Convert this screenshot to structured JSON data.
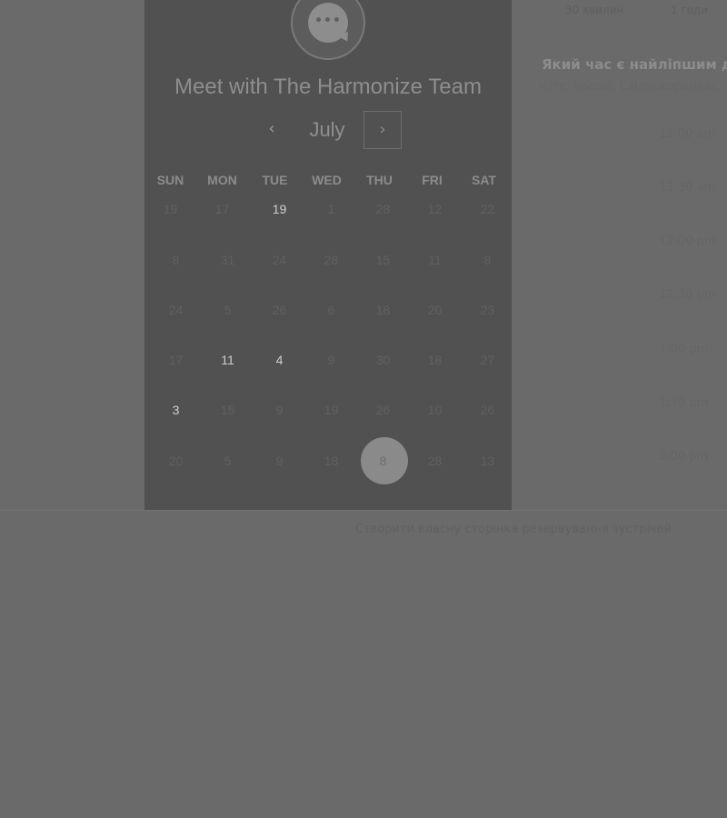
{
  "header": {
    "durations": [
      "30 хвилин",
      "1 годи"
    ]
  },
  "calendar": {
    "title": "Meet with The Harmonize Team",
    "month": "July",
    "prev_icon": "‹",
    "next_icon": "›",
    "weekdays": [
      "SUN",
      "MON",
      "TUE",
      "WED",
      "THU",
      "FRI",
      "SAT"
    ],
    "weeks": [
      [
        "19",
        "17",
        "19",
        "1",
        "28",
        "12",
        "22"
      ],
      [
        "8",
        "31",
        "24",
        "28",
        "15",
        "11",
        "8"
      ],
      [
        "24",
        "5",
        "26",
        "6",
        "18",
        "20",
        "23"
      ],
      [
        "17",
        "11",
        "4",
        "9",
        "30",
        "18",
        "27"
      ],
      [
        "3",
        "15",
        "9",
        "19",
        "26",
        "10",
        "26"
      ],
      [
        "20",
        "5",
        "9",
        "18",
        "8",
        "28",
        "13"
      ]
    ],
    "selected_day": "8"
  },
  "schedule": {
    "question": "Який час є найліпшим дл",
    "timezone": "ісіте, часові: Східноєвропейс",
    "slots": [
      "11:00 am",
      "11:30 am",
      "12:00 pm",
      "12:30 pm",
      "1:00 pm",
      "1:30 pm",
      "2:00 pm"
    ]
  },
  "footer": {
    "link_text": "Створити власну сторінка резервування зустрічей",
    "link_icon": "sparkle-icon"
  }
}
